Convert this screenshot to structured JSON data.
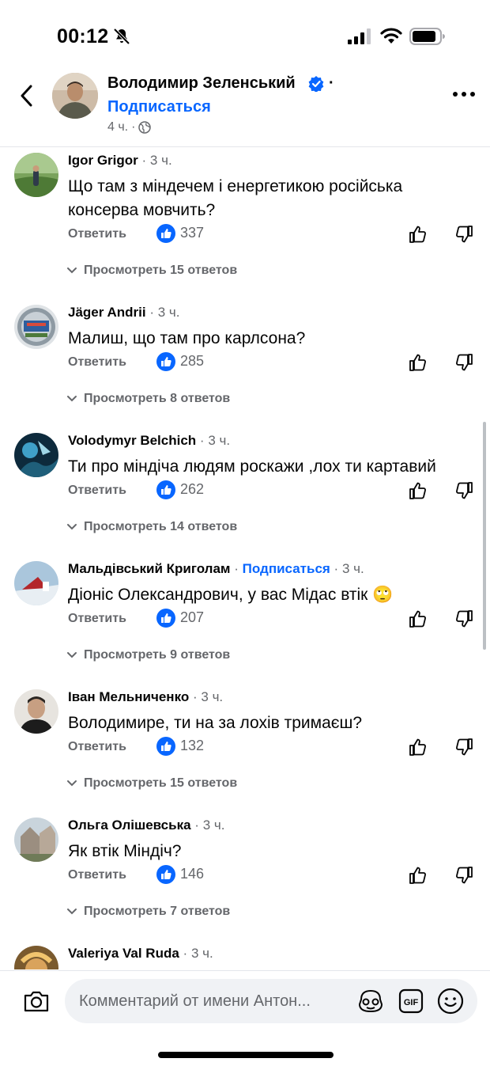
{
  "status_bar": {
    "time": "00:12"
  },
  "post": {
    "author": "Володимир Зеленський",
    "separator": "·",
    "follow": "Подписаться",
    "time": "4 ч.",
    "meta_dot": "·"
  },
  "comments": [
    {
      "name": "Igor Grigor",
      "time": "3 ч.",
      "text": "Що там з міндечем і енергетикою російська консерва мовчить?",
      "reply": "Ответить",
      "likes": "337",
      "view_replies": "Просмотреть 15 ответов"
    },
    {
      "name": "Jäger Andrii",
      "time": "3 ч.",
      "text": "Малиш, що там про карлсона?",
      "reply": "Ответить",
      "likes": "285",
      "view_replies": "Просмотреть 8 ответов"
    },
    {
      "name": "Volodymyr Belchich",
      "time": "3 ч.",
      "text": "Ти про міндіча людям роскажи ,лох ти картавий",
      "reply": "Ответить",
      "likes": "262",
      "view_replies": "Просмотреть 14 ответов"
    },
    {
      "name": "Мальдівський Криголам",
      "follow": "Подписаться",
      "time": "3 ч.",
      "text": "Діоніс Олександрович, у вас Мідас втік 🙄",
      "reply": "Ответить",
      "likes": "207",
      "view_replies": "Просмотреть 9 ответов"
    },
    {
      "name": "Іван Мельниченко",
      "time": "3 ч.",
      "text": "Володимире, ти на за лохів тримаєш?",
      "reply": "Ответить",
      "likes": "132",
      "view_replies": "Просмотреть 15 ответов"
    },
    {
      "name": "Ольга Олішевська",
      "time": "3 ч.",
      "text": "Як втік Міндіч?",
      "reply": "Ответить",
      "likes": "146",
      "view_replies": "Просмотреть 7 ответов"
    },
    {
      "name": "Valeriya Val Ruda",
      "time": "3 ч."
    }
  ],
  "dot": "·",
  "composer": {
    "placeholder": "Комментарий от имени Антон..."
  },
  "icons": {
    "like_badge": "like-badge-icon",
    "thumb_up": "thumb-up-icon",
    "thumb_down": "thumb-down-icon",
    "camera": "camera-icon",
    "gif": "gif-icon",
    "emoji": "emoji-icon",
    "avatar_sticker": "avatar-sticker-icon"
  },
  "colors": {
    "accent": "#0866ff",
    "secondary_text": "#65676b",
    "composer_bg": "#f0f2f5"
  }
}
